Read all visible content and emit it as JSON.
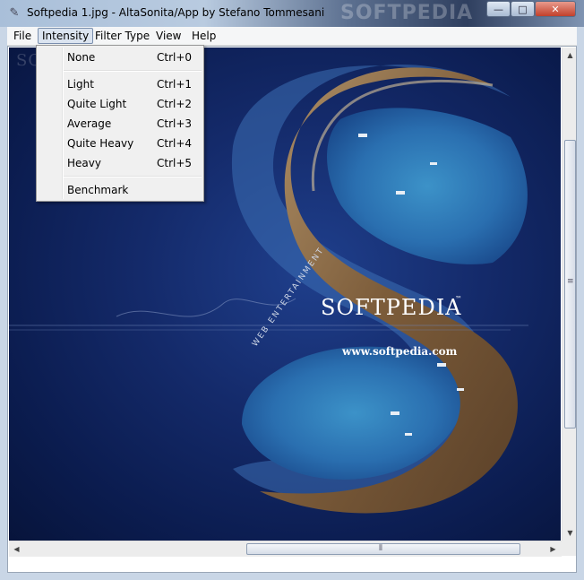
{
  "window": {
    "title": "Softpedia 1.jpg - AltaSonita/App by Stefano Tommesani",
    "title_watermark": "SOFTPEDIA",
    "controls": {
      "minimize": "—",
      "maximize": "□",
      "close": "✕"
    },
    "icon": "brush-icon"
  },
  "menubar": {
    "items": [
      {
        "label": "File"
      },
      {
        "label": "Intensity",
        "active": true
      },
      {
        "label": "Filter Type"
      },
      {
        "label": "View"
      },
      {
        "label": "Help"
      }
    ]
  },
  "intensity_menu": {
    "items": [
      {
        "label": "None",
        "shortcut": "Ctrl+0"
      },
      {
        "label": "Light",
        "shortcut": "Ctrl+1"
      },
      {
        "label": "Quite Light",
        "shortcut": "Ctrl+2"
      },
      {
        "label": "Average",
        "shortcut": "Ctrl+3"
      },
      {
        "label": "Quite Heavy",
        "shortcut": "Ctrl+4"
      },
      {
        "label": "Heavy",
        "shortcut": "Ctrl+5"
      },
      {
        "label": "Benchmark",
        "shortcut": ""
      }
    ]
  },
  "image": {
    "watermark": "SOFTPEDIA",
    "brand": "SOFTPEDIA",
    "brand_tm": "™",
    "url": "www.softpedia.com",
    "curve_text": "WEB ENTERTAINMENT"
  },
  "colors": {
    "sea_dark": "#0b1c4f",
    "sea": "#1f3f8c",
    "lagoon": "#2a7ab8",
    "rock": "#8a6a45"
  }
}
